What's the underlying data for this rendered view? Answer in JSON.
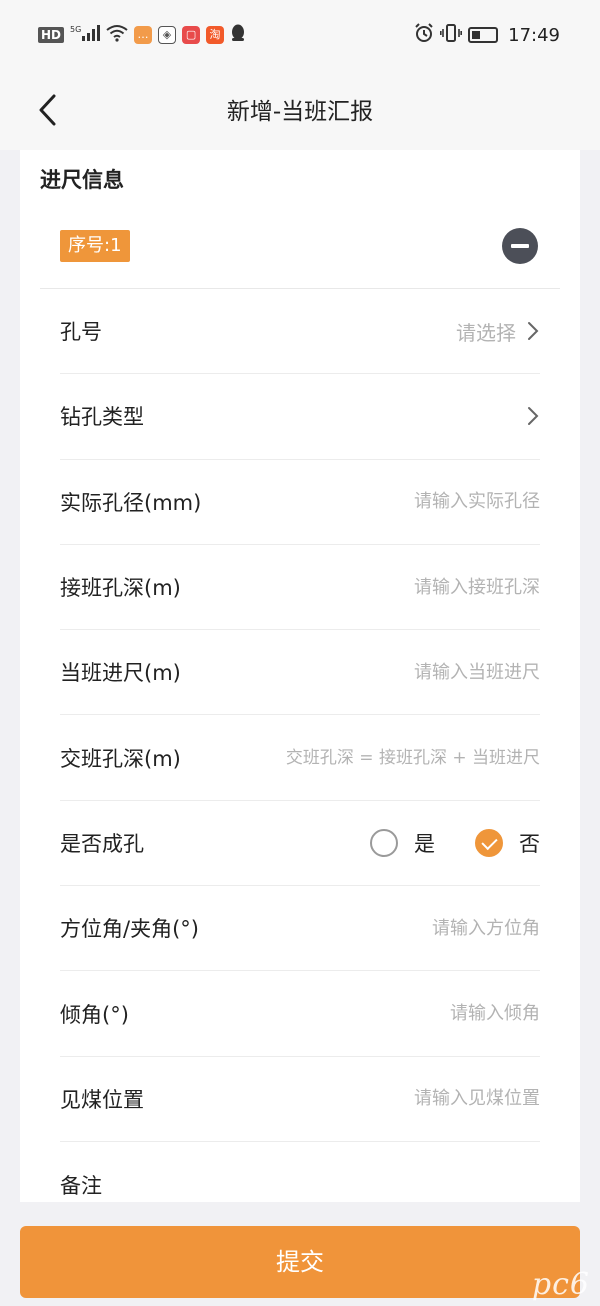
{
  "status_bar": {
    "left_icons": [
      "hd-icon",
      "5g-signal-icon",
      "wifi-icon",
      "message-app-icon",
      "shield-app-icon",
      "red-app-icon",
      "taobao-app-icon",
      "qq-penguin-icon"
    ],
    "right_icons": [
      "alarm-icon",
      "vibrate-icon",
      "battery-icon"
    ],
    "time": "17:49",
    "hd_label": "HD",
    "taobao_label": "淘"
  },
  "header": {
    "title": "新增-当班汇报"
  },
  "section": {
    "title": "进尺信息",
    "sequence_badge": "序号:1"
  },
  "fields": {
    "hole_number": {
      "label": "孔号",
      "placeholder": "请选择"
    },
    "drill_type": {
      "label": "钻孔类型",
      "placeholder": ""
    },
    "actual_diameter": {
      "label": "实际孔径(mm)",
      "placeholder": "请输入实际孔径"
    },
    "handover_depth": {
      "label": "接班孔深(m)",
      "placeholder": "请输入接班孔深"
    },
    "shift_footage": {
      "label": "当班进尺(m)",
      "placeholder": "请输入当班进尺"
    },
    "end_depth": {
      "label": "交班孔深(m)",
      "placeholder": "交班孔深 = 接班孔深 + 当班进尺"
    },
    "hole_formed": {
      "label": "是否成孔",
      "options": [
        "是",
        "否"
      ],
      "selected": "否"
    },
    "azimuth": {
      "label": "方位角/夹角(°)",
      "placeholder": "请输入方位角"
    },
    "inclination": {
      "label": "倾角(°)",
      "placeholder": "请输入倾角"
    },
    "coal_position": {
      "label": "见煤位置",
      "placeholder": "请输入见煤位置"
    },
    "remarks": {
      "label": "备注"
    }
  },
  "submit_label": "提交",
  "watermark": "pc6",
  "colors": {
    "accent": "#ef963a",
    "background": "#f1f1f4",
    "remove_button": "#4c4f58"
  }
}
